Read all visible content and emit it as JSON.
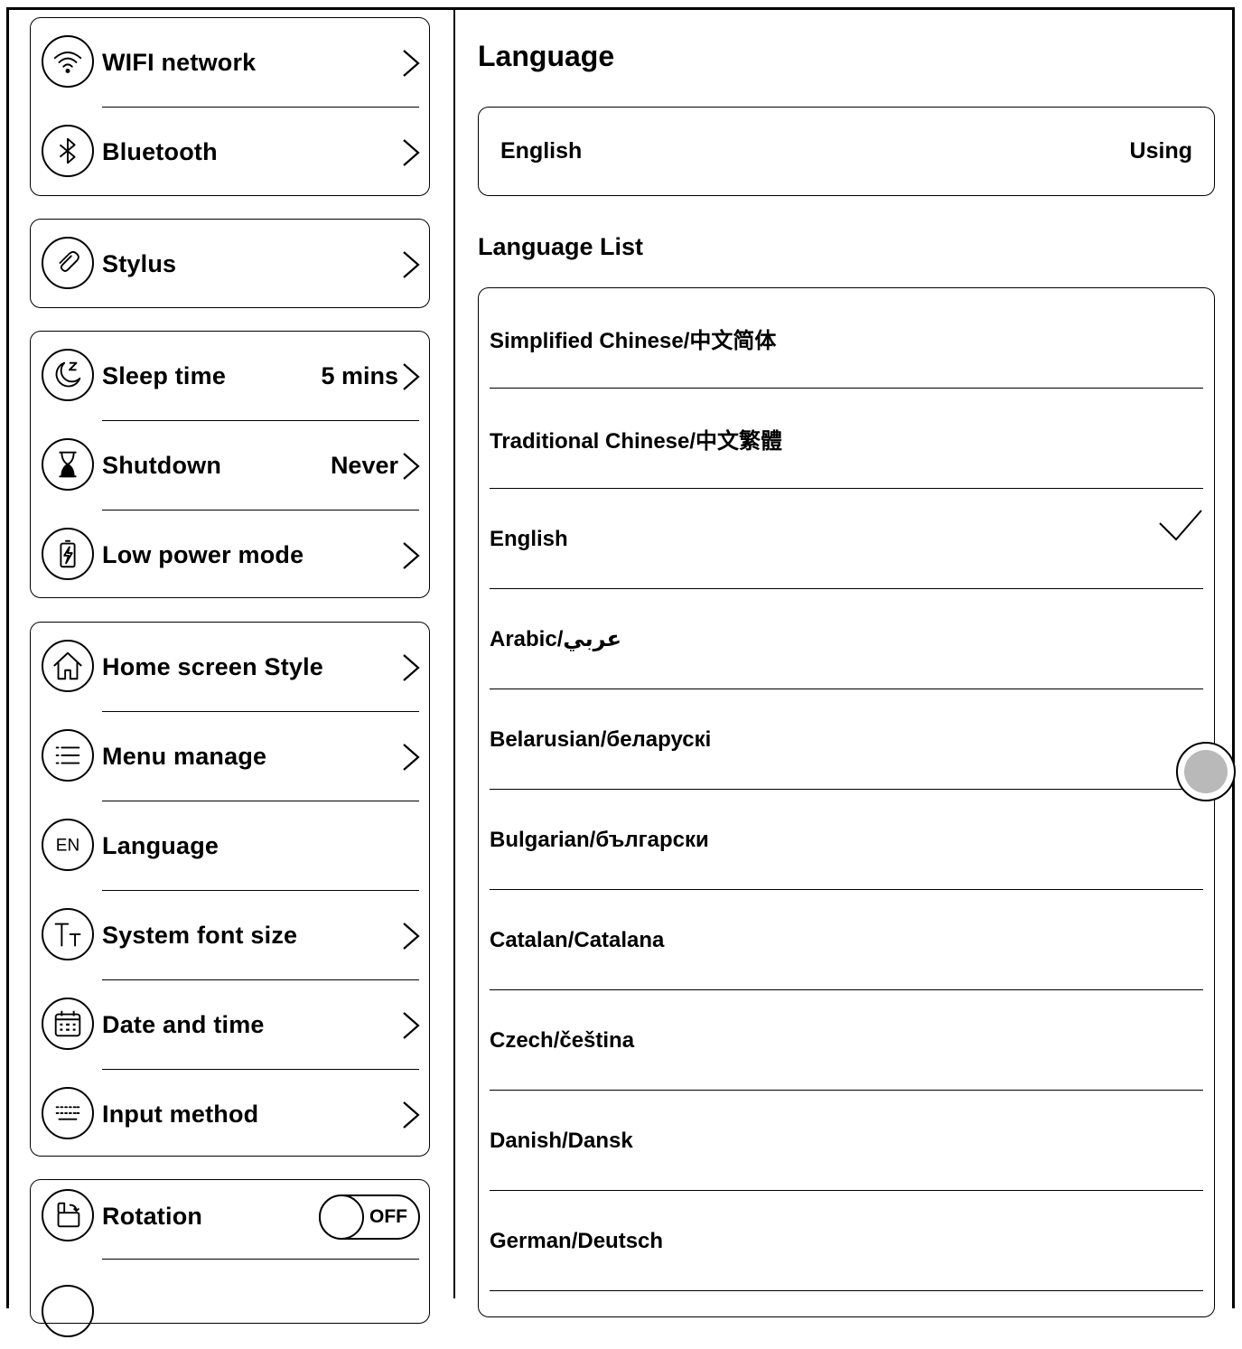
{
  "left_panel": {
    "group1": [
      {
        "label": "WIFI network",
        "icon": "wifi-icon",
        "has_chevron": true
      },
      {
        "label": "Bluetooth",
        "icon": "bluetooth-icon",
        "has_chevron": true
      }
    ],
    "group2": [
      {
        "label": "Stylus",
        "icon": "stylus-icon",
        "has_chevron": true
      }
    ],
    "group3": [
      {
        "label": "Sleep time",
        "value": "5 mins",
        "icon": "sleep-icon",
        "has_chevron": true
      },
      {
        "label": "Shutdown",
        "value": "Never",
        "icon": "hourglass-icon",
        "has_chevron": true
      },
      {
        "label": "Low power mode",
        "icon": "battery-icon",
        "has_chevron": true
      }
    ],
    "group4": [
      {
        "label": "Home screen Style",
        "icon": "home-icon",
        "has_chevron": true
      },
      {
        "label": "Menu manage",
        "icon": "menu-icon",
        "has_chevron": true
      },
      {
        "label": "Language",
        "icon": "language-en-icon",
        "has_chevron": false
      },
      {
        "label": "System font size",
        "icon": "font-size-icon",
        "has_chevron": true
      },
      {
        "label": "Date and time",
        "icon": "calendar-icon",
        "has_chevron": true
      },
      {
        "label": "Input method",
        "icon": "keyboard-icon",
        "has_chevron": true
      }
    ],
    "group5": [
      {
        "label": "Rotation",
        "icon": "rotation-icon",
        "toggle": "OFF"
      }
    ]
  },
  "right_panel": {
    "title": "Language",
    "current": {
      "language": "English",
      "status": "Using"
    },
    "list_title": "Language List",
    "languages": [
      {
        "name": "Simplified Chinese/中文简体",
        "selected": false
      },
      {
        "name": "Traditional Chinese/中文繁體",
        "selected": false
      },
      {
        "name": "English",
        "selected": true
      },
      {
        "name": "Arabic/عربي",
        "selected": false
      },
      {
        "name": "Belarusian/беларускі",
        "selected": false
      },
      {
        "name": "Bulgarian/български",
        "selected": false
      },
      {
        "name": "Catalan/Catalana",
        "selected": false
      },
      {
        "name": "Czech/čeština",
        "selected": false
      },
      {
        "name": "Danish/Dansk",
        "selected": false
      },
      {
        "name": "German/Deutsch",
        "selected": false
      }
    ]
  }
}
